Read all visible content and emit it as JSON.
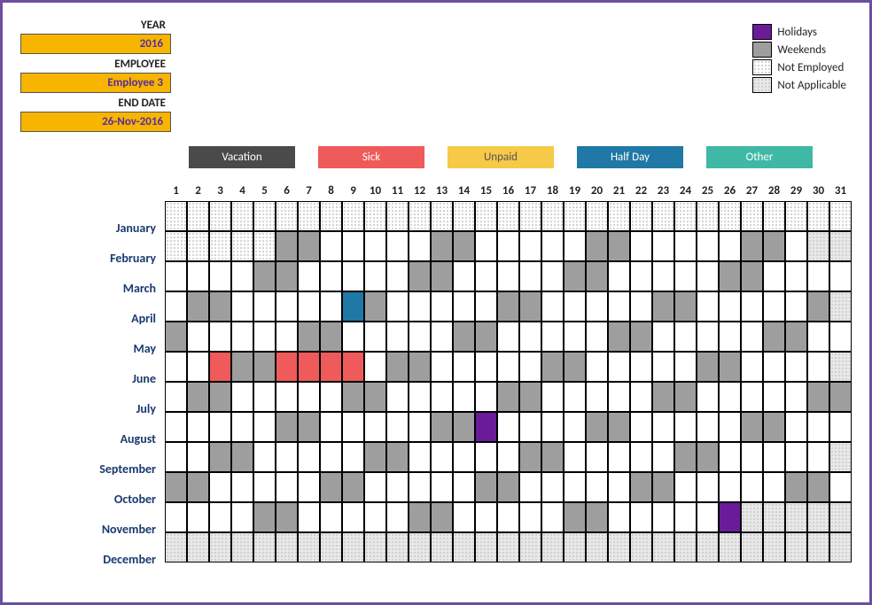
{
  "meta": {
    "year_label": "YEAR",
    "year_value": "2016",
    "employee_label": "EMPLOYEE",
    "employee_value": "Employee 3",
    "end_date_label": "END DATE",
    "end_date_value": "26-Nov-2016"
  },
  "key_legend": {
    "holidays": "Holidays",
    "weekends": "Weekends",
    "not_employed": "Not Employed",
    "not_applicable": "Not Applicable"
  },
  "type_legend": {
    "vacation": "Vacation",
    "sick": "Sick",
    "unpaid": "Unpaid",
    "half_day": "Half Day",
    "other": "Other"
  },
  "day_headers": [
    "1",
    "2",
    "3",
    "4",
    "5",
    "6",
    "7",
    "8",
    "9",
    "10",
    "11",
    "12",
    "13",
    "14",
    "15",
    "16",
    "17",
    "18",
    "19",
    "20",
    "21",
    "22",
    "23",
    "24",
    "25",
    "26",
    "27",
    "28",
    "29",
    "30",
    "31"
  ],
  "months": [
    {
      "label": "January",
      "days": [
        "ne",
        "ne",
        "ne",
        "ne",
        "ne",
        "ne",
        "ne",
        "ne",
        "ne",
        "ne",
        "ne",
        "ne",
        "ne",
        "ne",
        "ne",
        "ne",
        "ne",
        "ne",
        "ne",
        "ne",
        "ne",
        "ne",
        "ne",
        "ne",
        "ne",
        "ne",
        "ne",
        "ne",
        "ne",
        "ne",
        "ne"
      ]
    },
    {
      "label": "February",
      "days": [
        "ne",
        "ne",
        "ne",
        "ne",
        "ne",
        "we",
        "we",
        "",
        "",
        "",
        "",
        "",
        "we",
        "we",
        "",
        "",
        "",
        "",
        "",
        "we",
        "we",
        "",
        "",
        "",
        "",
        "",
        "we",
        "we",
        "",
        "na",
        "na"
      ]
    },
    {
      "label": "March",
      "days": [
        "",
        "",
        "",
        "",
        "we",
        "we",
        "",
        "",
        "",
        "",
        "",
        "we",
        "we",
        "",
        "",
        "",
        "",
        "",
        "we",
        "we",
        "",
        "",
        "",
        "",
        "",
        "we",
        "we",
        "",
        "",
        "",
        ""
      ]
    },
    {
      "label": "April",
      "days": [
        "",
        "we",
        "we",
        "",
        "",
        "",
        "",
        "",
        "half",
        "we",
        "",
        "",
        "",
        "",
        "",
        "we",
        "we",
        "",
        "",
        "",
        "",
        "",
        "we",
        "we",
        "",
        "",
        "",
        "",
        "",
        "we",
        "na"
      ]
    },
    {
      "label": "May",
      "days": [
        "we",
        "",
        "",
        "",
        "",
        "",
        "we",
        "we",
        "",
        "",
        "",
        "",
        "",
        "we",
        "we",
        "",
        "",
        "",
        "",
        "",
        "we",
        "we",
        "",
        "",
        "",
        "",
        "",
        "we",
        "we",
        "",
        ""
      ]
    },
    {
      "label": "June",
      "days": [
        "",
        "",
        "sick",
        "we",
        "we",
        "sick",
        "sick",
        "sick",
        "sick",
        "",
        "we",
        "we",
        "",
        "",
        "",
        "",
        "",
        "we",
        "we",
        "",
        "",
        "",
        "",
        "",
        "we",
        "we",
        "",
        "",
        "",
        "",
        "na"
      ]
    },
    {
      "label": "July",
      "days": [
        "",
        "we",
        "we",
        "",
        "",
        "",
        "",
        "",
        "we",
        "we",
        "",
        "",
        "",
        "",
        "",
        "we",
        "we",
        "",
        "",
        "",
        "",
        "",
        "we",
        "we",
        "",
        "",
        "",
        "",
        "",
        "we",
        "we"
      ]
    },
    {
      "label": "August",
      "days": [
        "",
        "",
        "",
        "",
        "",
        "we",
        "we",
        "",
        "",
        "",
        "",
        "",
        "we",
        "we",
        "hol",
        "",
        "",
        "",
        "",
        "we",
        "we",
        "",
        "",
        "",
        "",
        "",
        "we",
        "we",
        "",
        "",
        ""
      ]
    },
    {
      "label": "September",
      "days": [
        "",
        "",
        "we",
        "we",
        "",
        "",
        "",
        "",
        "",
        "we",
        "we",
        "",
        "",
        "",
        "",
        "",
        "we",
        "we",
        "",
        "",
        "",
        "",
        "",
        "we",
        "we",
        "",
        "",
        "",
        "",
        "",
        "na"
      ]
    },
    {
      "label": "October",
      "days": [
        "we",
        "we",
        "",
        "",
        "",
        "",
        "",
        "we",
        "we",
        "",
        "",
        "",
        "",
        "",
        "we",
        "we",
        "",
        "",
        "",
        "",
        "",
        "we",
        "we",
        "",
        "",
        "",
        "",
        "",
        "we",
        "we",
        ""
      ]
    },
    {
      "label": "November",
      "days": [
        "",
        "",
        "",
        "",
        "we",
        "we",
        "",
        "",
        "",
        "",
        "",
        "we",
        "we",
        "",
        "",
        "",
        "",
        "",
        "we",
        "we",
        "",
        "",
        "",
        "",
        "",
        "hol",
        "na",
        "na",
        "na",
        "na",
        "na"
      ]
    },
    {
      "label": "December",
      "days": [
        "na",
        "na",
        "na",
        "na",
        "na",
        "na",
        "na",
        "na",
        "na",
        "na",
        "na",
        "na",
        "na",
        "na",
        "na",
        "na",
        "na",
        "na",
        "na",
        "na",
        "na",
        "na",
        "na",
        "na",
        "na",
        "na",
        "na",
        "na",
        "na",
        "na",
        "na"
      ]
    }
  ]
}
